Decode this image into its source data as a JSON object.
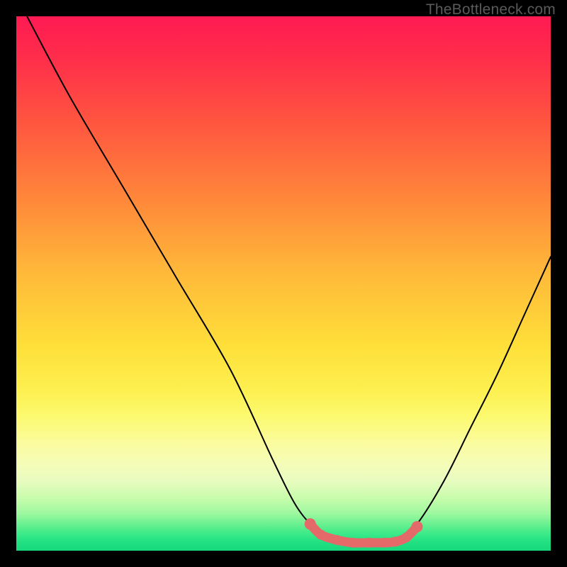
{
  "watermark": "TheBottleneck.com",
  "chart_data": {
    "type": "line",
    "title": "",
    "xlabel": "",
    "ylabel": "",
    "xlim": [
      0,
      100
    ],
    "ylim": [
      0,
      100
    ],
    "series": [
      {
        "name": "bottleneck-curve",
        "x": [
          2,
          10,
          20,
          30,
          40,
          48,
          52,
          55,
          58,
          60,
          63,
          68,
          72,
          75,
          80,
          85,
          90,
          95,
          100
        ],
        "values": [
          100,
          85,
          68,
          51,
          34,
          17,
          9,
          5,
          2.5,
          1.5,
          1.5,
          1.5,
          2.5,
          5,
          13,
          23,
          33,
          44,
          55
        ]
      }
    ],
    "markers": {
      "name": "highlight-band",
      "x": [
        55,
        57,
        60,
        63,
        66,
        69,
        71,
        73,
        75
      ],
      "values": [
        5,
        3,
        2,
        1.5,
        1.5,
        1.5,
        1.7,
        2.5,
        4.5
      ]
    },
    "colors": {
      "curve": "#000000",
      "marker": "#e46a6a",
      "gradient_top": "#ff1a53",
      "gradient_mid": "#ffe03a",
      "gradient_bottom": "#18d87d"
    }
  }
}
